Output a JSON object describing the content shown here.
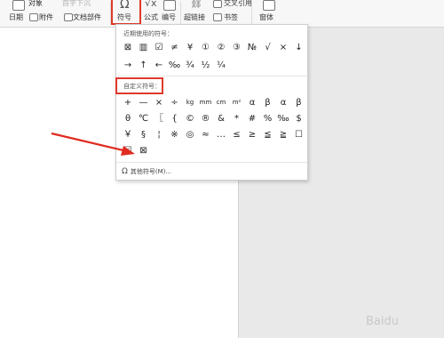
{
  "ribbon": {
    "object_label": "对象",
    "object_sub_label": "首字下沉",
    "date_label": "日期",
    "attachment_label": "附件",
    "docparts_label": "文档部件",
    "symbol_label": "符号",
    "formula_label": "公式",
    "number_label": "编号",
    "hyperlink_label": "超链接",
    "crossref_label": "交叉引用",
    "bookmark_label": "书签",
    "window_label": "窗体"
  },
  "popup": {
    "recent_title": "近期使用的符号：",
    "recent_symbols": [
      "⊠",
      "▥",
      "☑",
      "≠",
      "¥",
      "①",
      "②",
      "③",
      "№",
      "√",
      "×",
      "↓",
      "→",
      "↑",
      "←",
      "‰",
      "¾",
      "½",
      "¼"
    ],
    "custom_title": "自定义符号：",
    "custom_symbols": [
      "+",
      "—",
      "×",
      "÷",
      "kg",
      "mm",
      "cm",
      "m²",
      "α",
      "β",
      "α",
      "β",
      "θ",
      "℃",
      "〖",
      "{",
      "©",
      "®",
      "&",
      "*",
      "#",
      "%",
      "‰",
      "$",
      "￥",
      "§",
      "¦",
      "※",
      "◎",
      "≈",
      "…",
      "≤",
      "≥",
      "≦",
      "≧",
      "☐",
      "☑",
      "⊠"
    ],
    "more_label": "其他符号(M)..."
  },
  "watermark": "Baidu"
}
